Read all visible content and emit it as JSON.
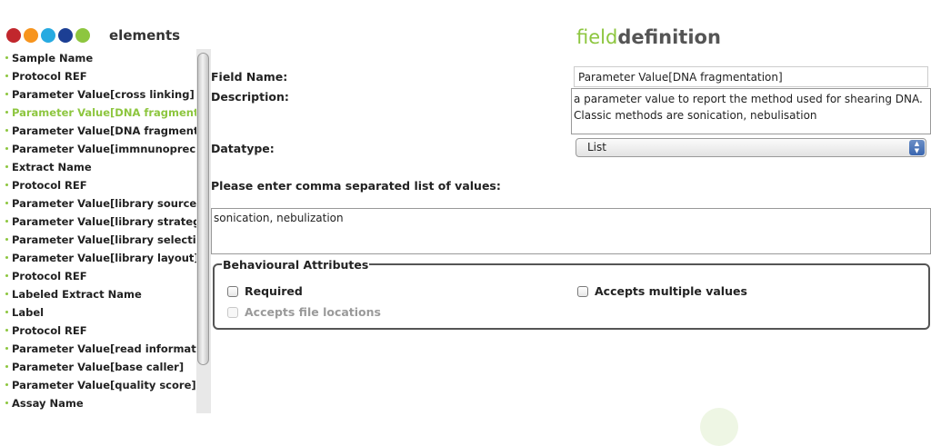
{
  "sidebar": {
    "title": "elements",
    "dots": [
      {
        "color": "#c1272d"
      },
      {
        "color": "#f7941d"
      },
      {
        "color": "#27aae1"
      },
      {
        "color": "#1c3f94"
      },
      {
        "color": "#8dc63f"
      }
    ],
    "items": [
      {
        "label": "Sample Name"
      },
      {
        "label": "Protocol REF"
      },
      {
        "label": "Parameter Value[cross linking]"
      },
      {
        "label": "Parameter Value[DNA fragmentation]",
        "selected": true
      },
      {
        "label": "Parameter Value[DNA fragment size]"
      },
      {
        "label": "Parameter Value[immnunoprecipitation antibody]"
      },
      {
        "label": "Extract Name"
      },
      {
        "label": "Protocol REF"
      },
      {
        "label": "Parameter Value[library source]"
      },
      {
        "label": "Parameter Value[library strategy]"
      },
      {
        "label": "Parameter Value[library selection]"
      },
      {
        "label": "Parameter Value[library layout]"
      },
      {
        "label": "Protocol REF"
      },
      {
        "label": "Labeled Extract Name"
      },
      {
        "label": "Label"
      },
      {
        "label": "Protocol REF"
      },
      {
        "label": "Parameter Value[read information]"
      },
      {
        "label": "Parameter Value[base caller]"
      },
      {
        "label": "Parameter Value[quality score]"
      },
      {
        "label": "Assay Name"
      }
    ]
  },
  "header": {
    "logo_part1": "field",
    "logo_part2": "definition",
    "accent_color": "#8dc63f"
  },
  "form": {
    "field_name_label": "Field Name:",
    "field_name_value": "Parameter Value[DNA fragmentation]",
    "description_label": "Description:",
    "description_value": "a parameter value to report the method used for shearing DNA. Classic methods are sonication, nebulisation",
    "datatype_label": "Datatype:",
    "datatype_value": "List",
    "values_prompt": "Please enter comma separated list of values:",
    "values_text": "sonication, nebulization"
  },
  "behaviour": {
    "legend": "Behavioural Attributes",
    "required_label": "Required",
    "multiple_label": "Accepts multiple values",
    "file_locations_label": "Accepts file locations"
  }
}
